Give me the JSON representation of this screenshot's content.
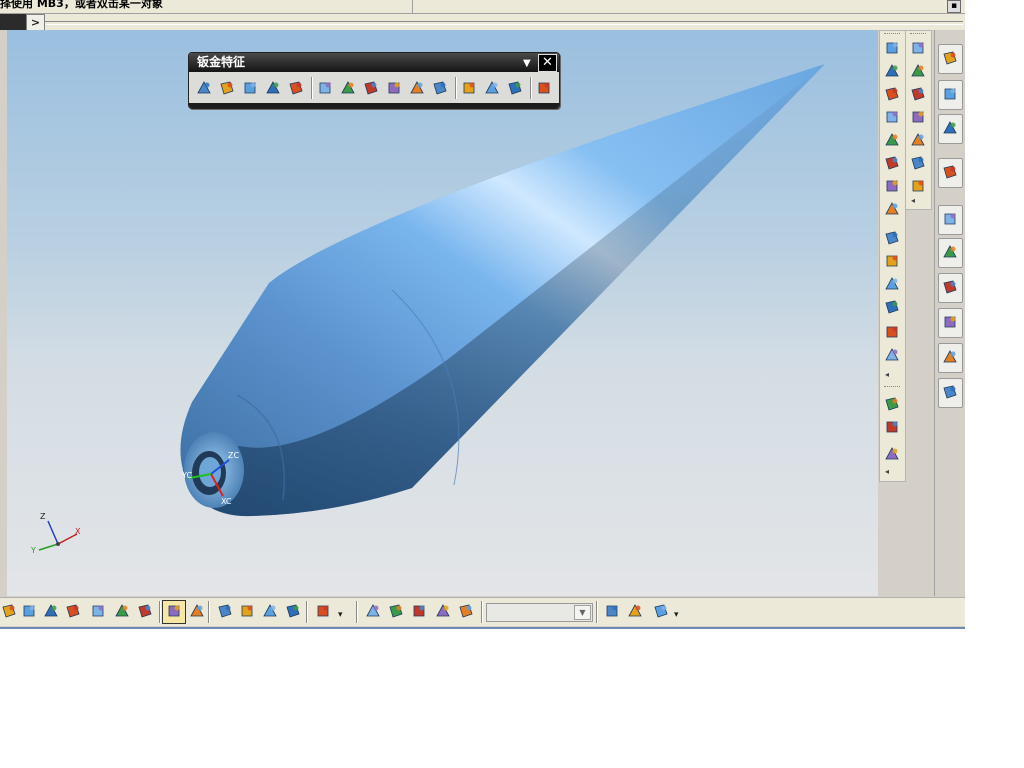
{
  "status_bar": {
    "prompt": "择使用 MB3，或者双击某一对象"
  },
  "command_row": {
    "expand_glyph": ">"
  },
  "floating_toolbar": {
    "title": "钣金特征",
    "close_glyph": "✕",
    "menu_glyph": "▼",
    "icons": [
      "sheet-metal-bend-icon",
      "sheet-metal-flange-icon",
      "sheet-metal-contour-icon",
      "sheet-metal-corner-icon",
      "sheet-metal-unbend-icon",
      "sheet-metal-plate-icon",
      "sheet-metal-tab-icon",
      "sheet-metal-joggle-icon",
      "sheet-metal-louver-icon",
      "sheet-metal-bead-icon",
      "sheet-metal-punch-icon",
      "sheet-metal-solid-punch-icon",
      "sheet-metal-cutout-icon",
      "sheet-metal-flat-pattern-icon",
      "sheet-metal-export-icon"
    ]
  },
  "viewport": {
    "wcs_labels": {
      "z": "ZC",
      "x": "XC",
      "y": "YC"
    },
    "triad_labels": {
      "z": "Z",
      "x": "X",
      "y": "Y"
    },
    "model_color": "#7fb6ea",
    "background_top": "#9abfdf",
    "background_bottom": "#e3e5e7"
  },
  "right_toolbar_1": {
    "icons": [
      "extrude-icon",
      "revolve-icon",
      "sweep-icon",
      "hole-icon",
      "boss-icon",
      "pocket-icon",
      "pad-icon",
      "slot-icon",
      "blend-icon",
      "chamfer-icon",
      "shell-icon",
      "thicken-icon",
      "trim-body-icon",
      "split-body-icon",
      "boolean-unite-icon",
      "offset-face-icon",
      "datum-plane-icon"
    ]
  },
  "right_toolbar_2": {
    "icons": [
      "zoom-icon",
      "pan-icon",
      "curve-icon",
      "intersection-icon",
      "spline-icon",
      "bridge-curve-icon",
      "project-curve-icon"
    ]
  },
  "resource_bar": {
    "tabs": [
      "assembly-navigator-icon",
      "part-navigator-icon",
      "reuse-library-icon",
      "web-browser-icon",
      "history-icon",
      "system-materials-icon",
      "visualization-icon",
      "process-studio-icon",
      "roles-icon",
      "background-icon"
    ]
  },
  "bottom_toolbar": {
    "icons": [
      "select-face-icon",
      "snap-endpoint-icon",
      "snap-midpoint-icon",
      "snap-control-icon",
      "snap-intersection-icon",
      "snap-center-icon",
      "snap-quadrant-icon",
      "snap-existing-point-icon",
      "snap-point-on-curve-icon",
      "view-fit-icon",
      "view-orient-icon",
      "view-render-icon",
      "view-section-icon",
      "layer-icon",
      "filter-face-icon",
      "filter-body-icon",
      "filter-edge-icon",
      "filter-component-icon",
      "filter-feature-icon",
      "filter-point-icon",
      "filter-curve-icon",
      "curve-rule-icon"
    ],
    "combo_value": ""
  }
}
